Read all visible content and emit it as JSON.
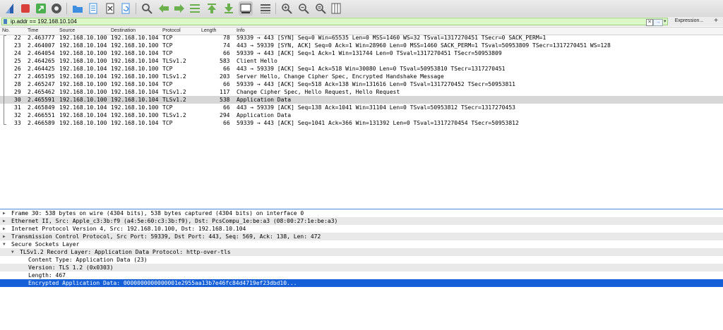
{
  "toolbar": {
    "icons": [
      "shark-fin-start-icon",
      "stop-icon",
      "restart-icon",
      "options-gear-icon",
      "open-folder-icon",
      "save-file-icon",
      "close-file-icon",
      "reload-icon",
      "find-icon",
      "go-back-icon",
      "go-forward-icon",
      "go-to-packet-icon",
      "go-first-icon",
      "go-last-icon",
      "autoscroll-icon",
      "colorize-icon",
      "zoom-in-icon",
      "zoom-out-icon",
      "zoom-normal-icon",
      "resize-columns-icon"
    ]
  },
  "filter": {
    "value": "ip.addr == 192.168.10.104",
    "clear_symbol": "✕",
    "apply_symbol": "→",
    "dropdown_symbol": "▾",
    "expression_label": "Expression...",
    "add_label": "+"
  },
  "columns": {
    "no": "No.",
    "time": "Time",
    "source": "Source",
    "destination": "Destination",
    "protocol": "Protocol",
    "length": "Length",
    "info": "Info"
  },
  "packets": [
    {
      "no": "22",
      "time": "2.463777",
      "source": "192.168.10.100",
      "destination": "192.168.10.104",
      "protocol": "TCP",
      "length": "78",
      "info": "59339 → 443 [SYN] Seq=0 Win=65535 Len=0 MSS=1460 WS=32 TSval=1317270451 TSecr=0 SACK_PERM=1"
    },
    {
      "no": "23",
      "time": "2.464007",
      "source": "192.168.10.104",
      "destination": "192.168.10.100",
      "protocol": "TCP",
      "length": "74",
      "info": "443 → 59339 [SYN, ACK] Seq=0 Ack=1 Win=28960 Len=0 MSS=1460 SACK_PERM=1 TSval=50953809 TSecr=1317270451 WS=128"
    },
    {
      "no": "24",
      "time": "2.464054",
      "source": "192.168.10.100",
      "destination": "192.168.10.104",
      "protocol": "TCP",
      "length": "66",
      "info": "59339 → 443 [ACK] Seq=1 Ack=1 Win=131744 Len=0 TSval=1317270451 TSecr=50953809"
    },
    {
      "no": "25",
      "time": "2.464265",
      "source": "192.168.10.100",
      "destination": "192.168.10.104",
      "protocol": "TLSv1.2",
      "length": "583",
      "info": "Client Hello"
    },
    {
      "no": "26",
      "time": "2.464425",
      "source": "192.168.10.104",
      "destination": "192.168.10.100",
      "protocol": "TCP",
      "length": "66",
      "info": "443 → 59339 [ACK] Seq=1 Ack=518 Win=30080 Len=0 TSval=50953810 TSecr=1317270451"
    },
    {
      "no": "27",
      "time": "2.465195",
      "source": "192.168.10.104",
      "destination": "192.168.10.100",
      "protocol": "TLSv1.2",
      "length": "203",
      "info": "Server Hello, Change Cipher Spec, Encrypted Handshake Message"
    },
    {
      "no": "28",
      "time": "2.465247",
      "source": "192.168.10.100",
      "destination": "192.168.10.104",
      "protocol": "TCP",
      "length": "66",
      "info": "59339 → 443 [ACK] Seq=518 Ack=138 Win=131616 Len=0 TSval=1317270452 TSecr=50953811"
    },
    {
      "no": "29",
      "time": "2.465462",
      "source": "192.168.10.100",
      "destination": "192.168.10.104",
      "protocol": "TLSv1.2",
      "length": "117",
      "info": "Change Cipher Spec, Hello Request, Hello Request"
    },
    {
      "no": "30",
      "time": "2.465591",
      "source": "192.168.10.100",
      "destination": "192.168.10.104",
      "protocol": "TLSv1.2",
      "length": "538",
      "info": "Application Data"
    },
    {
      "no": "31",
      "time": "2.465849",
      "source": "192.168.10.104",
      "destination": "192.168.10.100",
      "protocol": "TCP",
      "length": "66",
      "info": "443 → 59339 [ACK] Seq=138 Ack=1041 Win=31104 Len=0 TSval=50953812 TSecr=1317270453"
    },
    {
      "no": "32",
      "time": "2.466551",
      "source": "192.168.10.104",
      "destination": "192.168.10.100",
      "protocol": "TLSv1.2",
      "length": "294",
      "info": "Application Data"
    },
    {
      "no": "33",
      "time": "2.466589",
      "source": "192.168.10.100",
      "destination": "192.168.10.104",
      "protocol": "TCP",
      "length": "66",
      "info": "59339 → 443 [ACK] Seq=1041 Ack=366 Win=131392 Len=0 TSval=1317270454 TSecr=50953812"
    }
  ],
  "selected_packet": "30",
  "details": [
    {
      "text": "Frame 30: 538 bytes on wire (4304 bits), 538 bytes captured (4304 bits) on interface 0",
      "arrow": "▶",
      "level": 0
    },
    {
      "text": "Ethernet II, Src: Apple_c3:3b:f9 (a4:5e:60:c3:3b:f9), Dst: PcsCompu_1e:be:a3 (08:00:27:1e:be:a3)",
      "arrow": "▶",
      "level": 0
    },
    {
      "text": "Internet Protocol Version 4, Src: 192.168.10.100, Dst: 192.168.10.104",
      "arrow": "▶",
      "level": 0
    },
    {
      "text": "Transmission Control Protocol, Src Port: 59339, Dst Port: 443, Seq: 569, Ack: 138, Len: 472",
      "arrow": "▶",
      "level": 0
    },
    {
      "text": "Secure Sockets Layer",
      "arrow": "▼",
      "level": 0
    },
    {
      "text": "TLSv1.2 Record Layer: Application Data Protocol: http-over-tls",
      "arrow": "▼",
      "level": 1
    },
    {
      "text": "Content Type: Application Data (23)",
      "arrow": "",
      "level": 2
    },
    {
      "text": "Version: TLS 1.2 (0x0303)",
      "arrow": "",
      "level": 2
    },
    {
      "text": "Length: 467",
      "arrow": "",
      "level": 2
    },
    {
      "text": "Encrypted Application Data: 0000000000000001e2955aa13b7e46fc84d4719ef23dbd10...",
      "arrow": "",
      "level": 2
    }
  ],
  "colors": {
    "filter_bg": "#dcf7c8",
    "selected_row": "#d7d7d7",
    "selected_detail": "#1560d8"
  }
}
